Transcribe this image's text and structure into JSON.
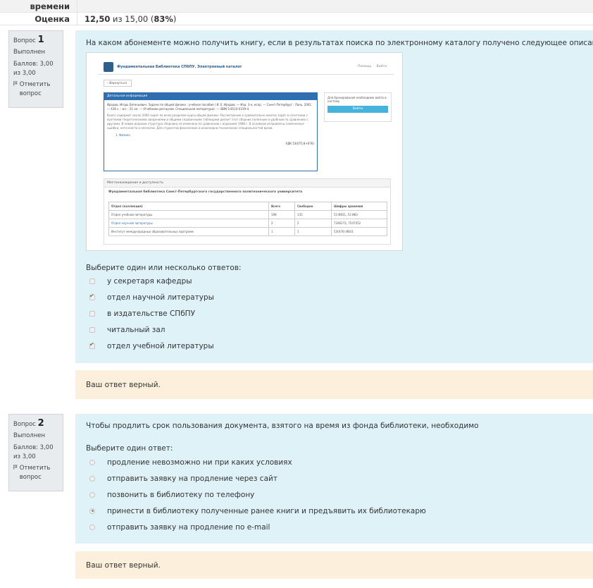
{
  "summary": {
    "time_label": "времени",
    "grade_label": "Оценка",
    "grade_score": "12,50",
    "grade_mid": " из 15,00 (",
    "grade_percent": "83%",
    "grade_end": ")"
  },
  "questions": [
    {
      "label": "Вопрос",
      "number": "1",
      "state": "Выполнен",
      "marks": "Баллов: 3,00 из 3,00",
      "flag_label": "Отметить вопрос",
      "text": "На каком абонементе можно получить книгу, если в результатах поиска по электронному каталогу получено следующее описание:",
      "prompt": "Выберите один или несколько ответов:",
      "options": [
        {
          "label": "у секретаря кафедры",
          "checked": false
        },
        {
          "label": "отдел научной литературы",
          "checked": true
        },
        {
          "label": "в издательстве СПбПУ",
          "checked": false
        },
        {
          "label": "читальный зал",
          "checked": false
        },
        {
          "label": "отдел учебной литературы",
          "checked": true
        }
      ],
      "feedback": "Ваш ответ верный."
    },
    {
      "label": "Вопрос",
      "number": "2",
      "state": "Выполнен",
      "marks": "Баллов: 3,00 из 3,00",
      "flag_label": "Отметить вопрос",
      "text": "Чтобы продлить срок пользования документа, взятого на время из фонда библиотеки, необходимо",
      "prompt": "Выберите один ответ:",
      "options": [
        {
          "label": "продление невозможно ни при каких условиях",
          "checked": false
        },
        {
          "label": "отправить заявку на продление через сайт",
          "checked": false
        },
        {
          "label": "позвонить в библиотеку по телефону",
          "checked": false
        },
        {
          "label": "принести в библиотеку полученные ранее книги и предъявить их библиотекарю",
          "checked": true
        },
        {
          "label": "отправить заявку на продление по e-mail",
          "checked": false
        }
      ],
      "feedback": "Ваш ответ верный."
    }
  ],
  "catalog": {
    "title": "Фундаментальная Библиотека СПбПУ. Электронный каталог",
    "links": "Помощь Войти",
    "back": "‹ Вернуться",
    "panel_header": "Детальная информация",
    "record": "Иродов, Игорь Евгеньевич. Задачи по общей физике : учебное пособие / И. Е. Иродов. — Изд. 3-е, испр. — Санкт-Петербург : Лань, 2001. — 416 с. : ил. ; 21 см. — (Учебники для вузов. Специальная литература). — ISBN 5-8114-0319-4.",
    "annotation": "Книга содержит около 2000 задач по всем разделам курса общей физики. Рассмотрение в сравнительно многих задач в сочетании с краткими теоретическими сведениями и общими справочными таблицами делает этот сборник полезным и удобным по сравнению с другими. В новом издании структура сборника не изменена по сравнению с изданием 1988 г. В основном исправлены замеченные ошибки, неточности и опечатки. Для студентов физических и инженерно-технических специальностей вузов.",
    "subject": "1. Физика",
    "udc": "УДК 53(075.8+076)",
    "side_text": "Для бронирования необходимо войти в систему",
    "side_button": "Войти",
    "loc_header": "Местонахождение и доступность",
    "loc_org": "Фундаментальная библиотека Санкт-Петербургского государственного политехнического университета",
    "table_head": [
      "Отдел (коллекция)",
      "Всего",
      "Свободно",
      "Шифры хранения"
    ],
    "table_rows": [
      [
        "Отдел учебной литературы",
        "198",
        "135",
        "53 И831, 53 И83"
      ],
      [
        "Отдел научной литературы",
        "2",
        "2",
        "7346272, 7547452"
      ],
      [
        "Институт международных образовательных программ",
        "1",
        "1",
        "53(076) И831"
      ]
    ]
  }
}
